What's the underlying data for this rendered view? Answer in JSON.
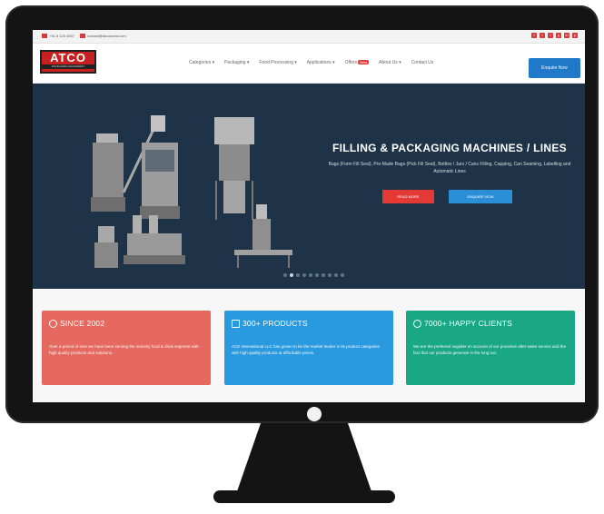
{
  "topbar": {
    "phone": "+91 8 123 4567",
    "email": "contact@atcoworld.com",
    "social": [
      "f",
      "t",
      "i",
      "g",
      "in",
      "y"
    ]
  },
  "brand": {
    "name": "ATCO",
    "tagline": "PACKAGING MACHINERY"
  },
  "nav": {
    "items": [
      "Categories ▾",
      "Packaging ▾",
      "Food Processing ▾",
      "Applications ▾",
      "Offers",
      "About Us ▾",
      "Contact Us"
    ],
    "offers_badge": "New",
    "enquire_button": "Enquire Now"
  },
  "hero": {
    "title": "FILLING & PACKAGING MACHINES / LINES",
    "subtitle": "Bags (Form Fill Seal), Pre-Made Bags (Pick Fill Seal), Bottles / Jars / Cans Filling, Capping, Can Seaming, Labelling and Automatic Lines",
    "read_more": "READ MORE",
    "enquire": "ENQUIRE NOW",
    "slide_count": 10,
    "active_slide": 2
  },
  "cards": [
    {
      "title": "SINCE 2002",
      "text": "Over a period of time we have been serving the industry food & drink segment with high quality products and solutions."
    },
    {
      "title": "300+ PRODUCTS",
      "text": "ACE International LLC has grown to be the market leader in its product categories with high quality products at affordable prices."
    },
    {
      "title": "7000+ HAPPY CLIENTS",
      "text": "We are the preferred supplier on account of our proactive after-sales service and the fact that our products generate in the long run."
    }
  ],
  "colors": {
    "brand_red": "#c62020",
    "hero_bg": "#1e3347",
    "card_coral": "#e5695e",
    "card_blue": "#2a9ae0",
    "card_teal": "#1aa884"
  }
}
